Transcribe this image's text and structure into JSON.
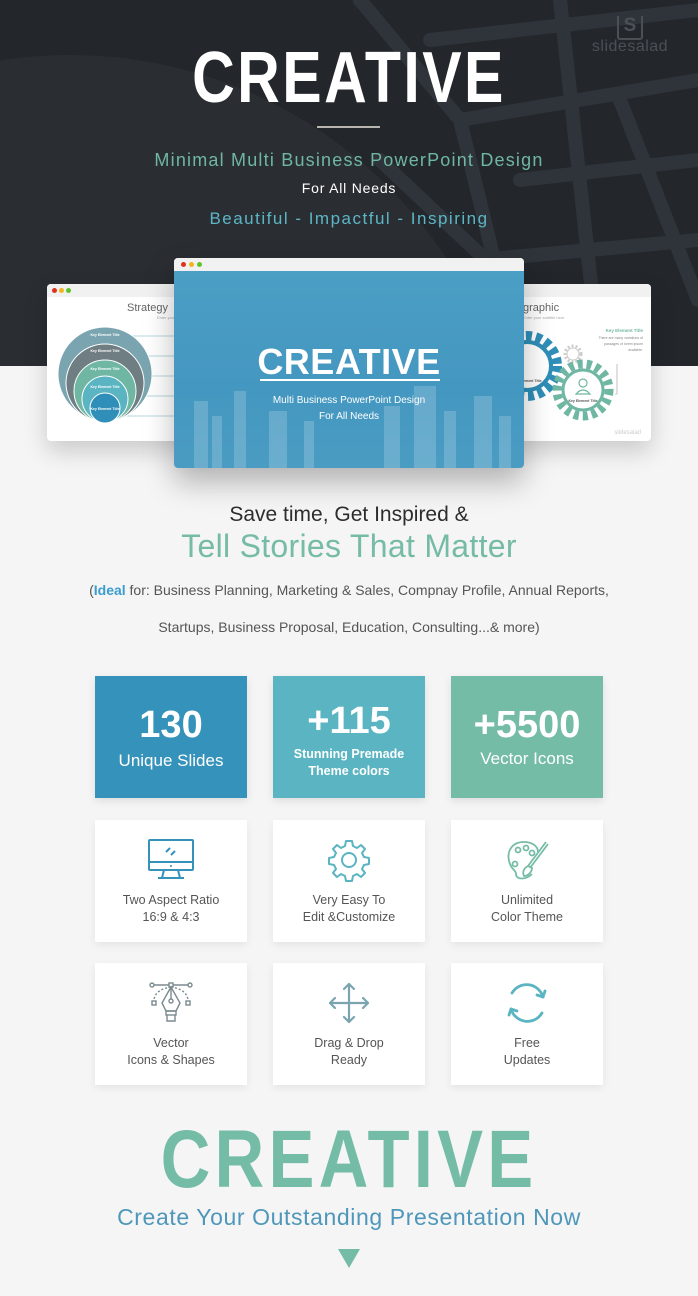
{
  "brand": {
    "logo_letter": "S",
    "name": "slidesalad"
  },
  "hero": {
    "title": "CREATIVE",
    "subtitle": "Minimal Multi Business PowerPoint Design",
    "subtitle2": "For All Needs",
    "tagline": "Beautiful - Impactful - Inspiring"
  },
  "mockups": {
    "left": {
      "title": "Strategy",
      "subtitle": "Enter your subtitle here",
      "rings": [
        "Key Element Title",
        "Key Element Title",
        "Key Element Title",
        "Key Element Title",
        "Key Element Title"
      ],
      "ring_colors": [
        "#7aa5b0",
        "#6f7e82",
        "#6fb7a2",
        "#5ab4c1",
        "#2f8fb8"
      ]
    },
    "center": {
      "title": "CREATIVE",
      "subtitle": "Multi Business PowerPoint Design",
      "subtitle2": "For All Needs"
    },
    "right": {
      "title": "graphic",
      "subtitle": "Enter your subtitle here",
      "key_title": "Key Element Title",
      "key_desc": "There are many variations of passages of lorem ipsum available.",
      "gear1_label": "Key Element Title",
      "gear2_label": "Key Element Title",
      "brand": "slidesalad"
    }
  },
  "tagline": {
    "line1": "Save time, Get Inspired &",
    "line2": "Tell Stories That Matter",
    "ideal_open": "(",
    "ideal_word": "Ideal",
    "ideal_rest": " for: Business Planning, Marketing & Sales, Compnay Profile, Annual Reports,",
    "ideal_line2": "Startups, Business Proposal, Education, Consulting...& more)"
  },
  "stats": [
    {
      "value": "130",
      "label": "Unique Slides",
      "color": "#3592bb"
    },
    {
      "value": "+115",
      "label_line1": "Stunning Premade",
      "label_line2": "Theme colors",
      "color": "#5ab4c1"
    },
    {
      "value": "+5500",
      "label": "Vector Icons",
      "color": "#75bca6"
    }
  ],
  "features": [
    {
      "icon": "monitor-icon",
      "line1": "Two Aspect Ratio",
      "line2": "16:9 & 4:3"
    },
    {
      "icon": "gear-icon",
      "line1": "Very Easy To",
      "line2": "Edit &Customize"
    },
    {
      "icon": "palette-icon",
      "line1": "Unlimited",
      "line2": "Color Theme"
    },
    {
      "icon": "pen-tool-icon",
      "line1": "Vector",
      "line2": "Icons & Shapes"
    },
    {
      "icon": "move-arrows-icon",
      "line1": "Drag & Drop",
      "line2": "Ready"
    },
    {
      "icon": "refresh-icon",
      "line1": "Free",
      "line2": "Updates"
    }
  ],
  "footer": {
    "title": "CREATIVE",
    "subtitle": "Create Your Outstanding Presentation Now"
  },
  "colors": {
    "dark_bg": "#23272c",
    "blue": "#3592bb",
    "teal": "#5ab4c1",
    "green": "#75bca6",
    "page_bg": "#f5f5f5"
  }
}
